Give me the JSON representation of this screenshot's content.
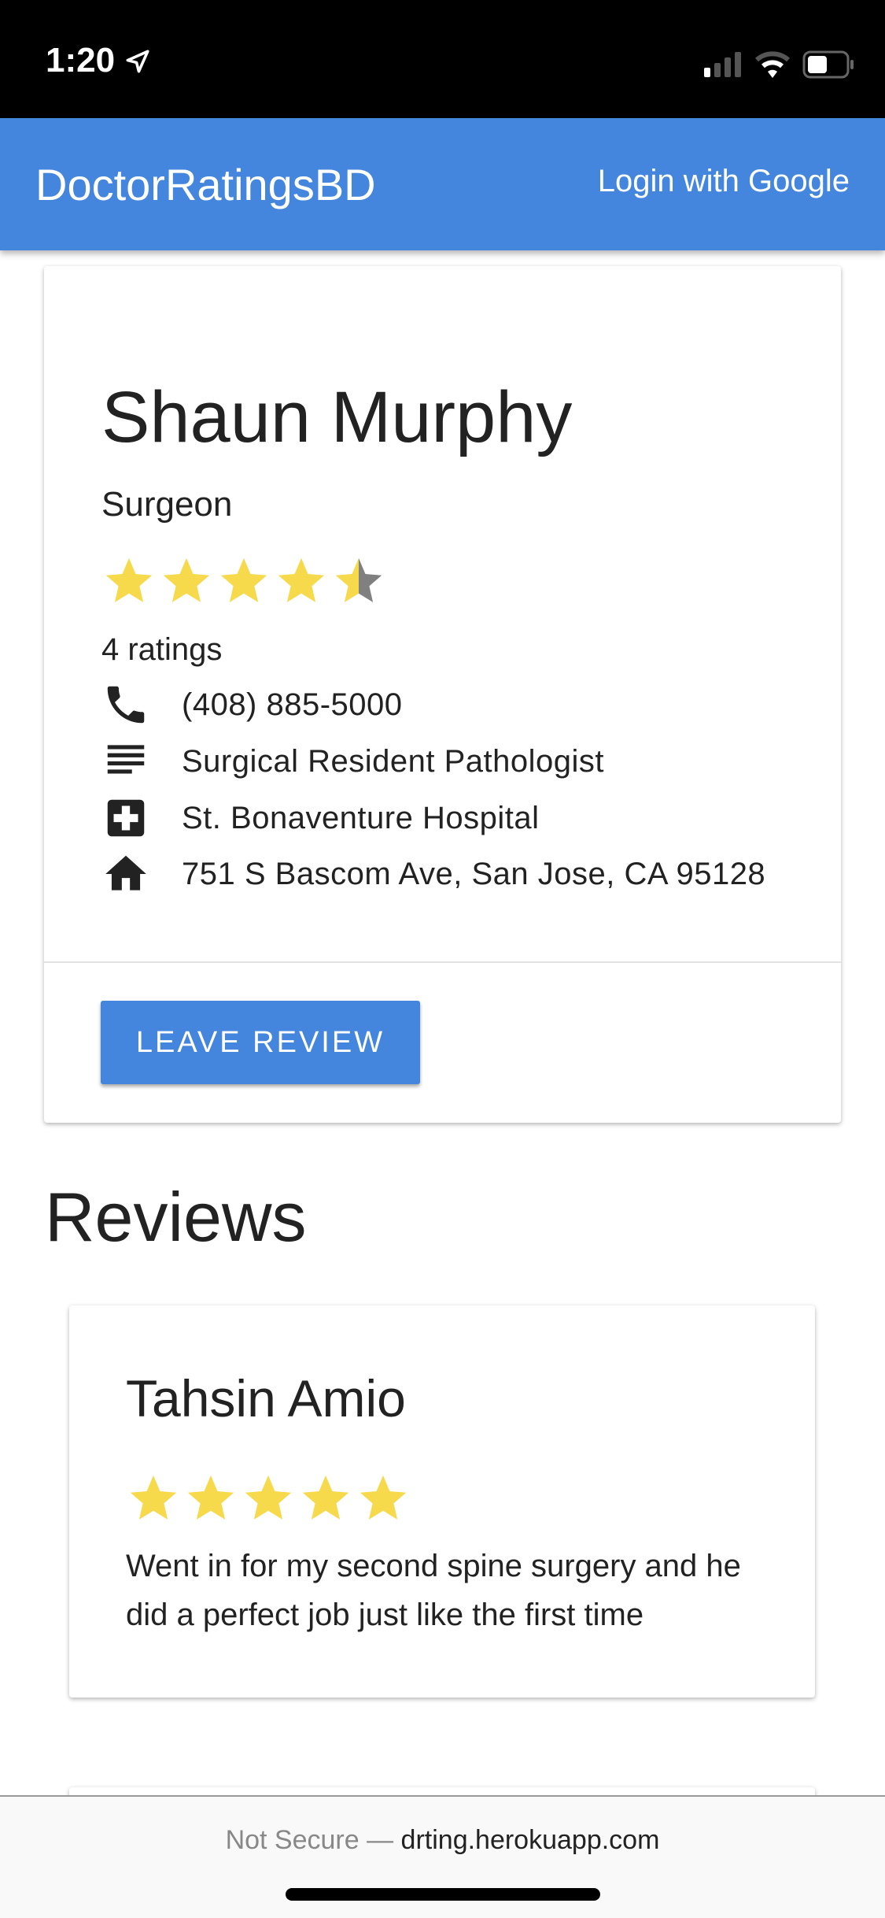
{
  "status_bar": {
    "time": "1:20",
    "icons": [
      "location-arrow-icon",
      "cellular-signal-icon",
      "wifi-icon",
      "battery-icon"
    ]
  },
  "header": {
    "brand": "DoctorRatingsBD",
    "login": "Login with Google",
    "color": "#4486DD"
  },
  "doctor": {
    "name": "Shaun Murphy",
    "specialty": "Surgeon",
    "rating": 4.5,
    "rating_max": 5,
    "ratings_count": "4 ratings",
    "phone": "(408) 885-5000",
    "title": "Surgical Resident Pathologist",
    "hospital": "St. Bonaventure Hospital",
    "address": "751 S Bascom Ave, San Jose, CA 95128",
    "leave_review": "LEAVE REVIEW"
  },
  "reviews": {
    "heading": "Reviews",
    "items": [
      {
        "author": "Tahsin Amio",
        "rating": 5,
        "text": "Went in for my second spine surgery and he did a perfect job just like the first time"
      }
    ]
  },
  "browser": {
    "not_secure": "Not Secure —",
    "domain": "drting.herokuapp.com"
  },
  "colors": {
    "star": "#F7D94C",
    "star_empty": "#808080"
  }
}
